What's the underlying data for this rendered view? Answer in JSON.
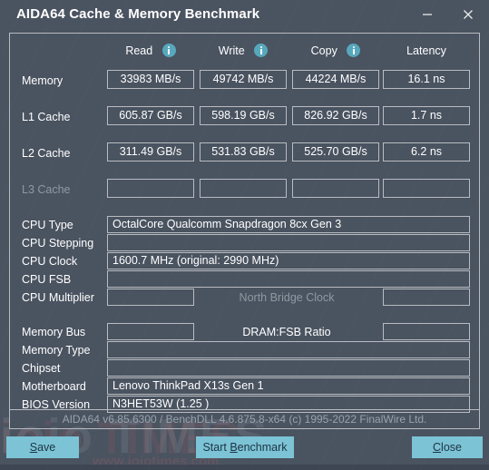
{
  "window": {
    "title": "AIDA64 Cache & Memory Benchmark",
    "minimize_label": "minimize",
    "close_label": "close"
  },
  "benchmark": {
    "columns": [
      {
        "label": "Read",
        "has_info": true
      },
      {
        "label": "Write",
        "has_info": true
      },
      {
        "label": "Copy",
        "has_info": true
      },
      {
        "label": "Latency",
        "has_info": false
      }
    ],
    "rows": [
      {
        "label": "Memory",
        "disabled": false,
        "read": "33983 MB/s",
        "write": "49742 MB/s",
        "copy": "44224 MB/s",
        "latency": "16.1 ns"
      },
      {
        "label": "L1 Cache",
        "disabled": false,
        "read": "605.87 GB/s",
        "write": "598.19 GB/s",
        "copy": "826.92 GB/s",
        "latency": "1.7 ns"
      },
      {
        "label": "L2 Cache",
        "disabled": false,
        "read": "311.49 GB/s",
        "write": "531.83 GB/s",
        "copy": "525.70 GB/s",
        "latency": "6.2 ns"
      },
      {
        "label": "L3 Cache",
        "disabled": true,
        "read": "",
        "write": "",
        "copy": "",
        "latency": ""
      }
    ]
  },
  "cpu_info": {
    "cpu_type_label": "CPU Type",
    "cpu_type_value": "OctalCore Qualcomm Snapdragon 8cx Gen 3",
    "cpu_stepping_label": "CPU Stepping",
    "cpu_stepping_value": "",
    "cpu_clock_label": "CPU Clock",
    "cpu_clock_value": "1600.7 MHz  (original: 2990 MHz)",
    "cpu_fsb_label": "CPU FSB",
    "cpu_fsb_value": "",
    "cpu_multiplier_label": "CPU Multiplier",
    "cpu_multiplier_value": "",
    "north_bridge_clock_label": "North Bridge Clock",
    "north_bridge_clock_value": ""
  },
  "memory_info": {
    "memory_bus_label": "Memory Bus",
    "memory_bus_value": "",
    "dram_fsb_ratio_label": "DRAM:FSB Ratio",
    "dram_fsb_ratio_value": "",
    "memory_type_label": "Memory Type",
    "memory_type_value": "",
    "chipset_label": "Chipset",
    "chipset_value": "",
    "motherboard_label": "Motherboard",
    "motherboard_value": "Lenovo ThinkPad X13s Gen 1",
    "bios_version_label": "BIOS Version",
    "bios_version_value": "N3HET53W (1.25 )"
  },
  "footer": {
    "credits": "AIDA64 v6.85.6300 / BenchDLL 4.6.875.8-x64  (c) 1995-2022 FinalWire Ltd."
  },
  "buttons": {
    "save": "Save",
    "save_accel": "S",
    "start_benchmark": "Start ",
    "start_benchmark_accel": "B",
    "start_benchmark_rest": "enchmark",
    "close": "Close",
    "close_accel": "C"
  },
  "watermark": {
    "main": "ioio TIMES",
    "sub": "www.ioiotimes.com"
  },
  "colors": {
    "window_bg": "#4a5360",
    "button_teal": "#7cc3d6",
    "border": "#b9bcc1",
    "info_icon": "#58a8bd",
    "disabled_text": "#8d9aa0"
  }
}
